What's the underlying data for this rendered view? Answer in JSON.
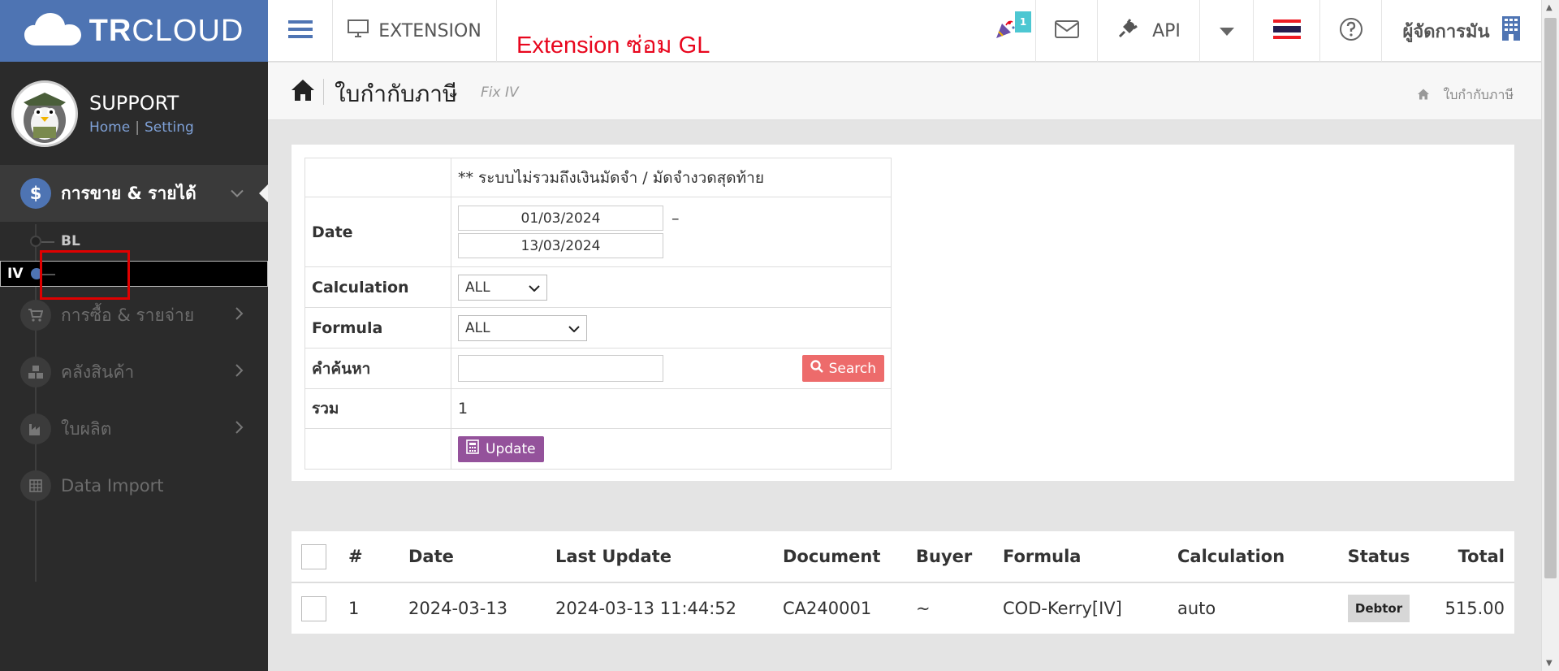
{
  "brand": {
    "logo_text_bold": "TR",
    "logo_text": "CLOUD"
  },
  "profile": {
    "name": "SUPPORT",
    "home_link": "Home",
    "setting_link": "Setting"
  },
  "sidebar": {
    "sales": {
      "label": "การขาย & รายได้",
      "icon": "dollar-icon",
      "symbol": "$"
    },
    "sub_items": [
      {
        "label": "BL"
      },
      {
        "label": "IV"
      }
    ],
    "items": [
      {
        "label": "การซื้อ & รายจ่าย",
        "icon": "cart-icon"
      },
      {
        "label": "คลังสินค้า",
        "icon": "cubes-icon"
      },
      {
        "label": "ใบผลิต",
        "icon": "factory-icon"
      },
      {
        "label": "Data Import",
        "icon": "table-icon"
      }
    ]
  },
  "topbar": {
    "extension_label": "EXTENSION",
    "page_banner": "Extension ซ่อม GL",
    "notification_count": "1",
    "api_label": "API",
    "user_name": "ผู้จัดการมัน"
  },
  "header": {
    "title": "ใบกำกับภาษี",
    "subtitle": "Fix IV",
    "breadcrumb": "ใบกำกับภาษี"
  },
  "filter": {
    "note": "** ระบบไม่รวมถึงเงินมัดจำ / มัดจำงวดสุดท้าย",
    "date_label": "Date",
    "date_from": "01/03/2024",
    "date_separator": "–",
    "date_to": "13/03/2024",
    "calculation_label": "Calculation",
    "calculation_value": "ALL",
    "formula_label": "Formula",
    "formula_value": "ALL",
    "search_label": "คำค้นหา",
    "search_value": "",
    "search_button": "Search",
    "total_label": "รวม",
    "total_value": "1",
    "update_button": "Update"
  },
  "results": {
    "columns": [
      "#",
      "Date",
      "Last Update",
      "Document",
      "Buyer",
      "Formula",
      "Calculation",
      "Status",
      "Total"
    ],
    "rows": [
      {
        "no": "1",
        "date": "2024-03-13",
        "last_update": "2024-03-13 11:44:52",
        "document": "CA240001",
        "buyer": "~",
        "formula": "COD-Kerry[IV]",
        "calculation": "auto",
        "status": "Debtor",
        "total": "515.00"
      }
    ]
  },
  "colors": {
    "brand_blue": "#4e74b3",
    "banner_red": "#e8071e",
    "search_red": "#ed6b6b",
    "update_purple": "#94529b",
    "badge_teal": "#4dc7d2"
  }
}
